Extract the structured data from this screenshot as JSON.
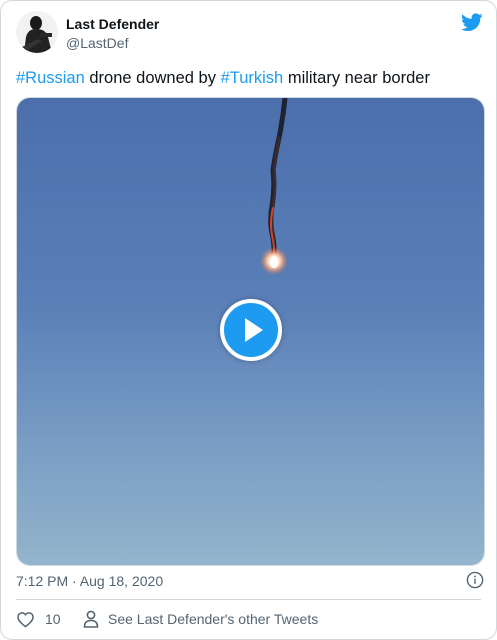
{
  "author": {
    "name": "Last Defender",
    "handle": "@LastDef"
  },
  "tweet": {
    "segments": [
      {
        "text": "#Russian",
        "hashtag": true
      },
      {
        "text": " drone downed by ",
        "hashtag": false
      },
      {
        "text": "#Turkish",
        "hashtag": true
      },
      {
        "text": " military near border",
        "hashtag": false
      }
    ],
    "timestamp": "7:12 PM · Aug 18, 2020"
  },
  "actions": {
    "like_count": "10",
    "other_tweets_label": "See Last Defender's other Tweets"
  },
  "icons": {
    "brand": "twitter-bird-icon",
    "play": "play-icon",
    "info": "info-icon",
    "like": "heart-icon",
    "profile": "person-icon"
  },
  "colors": {
    "accent": "#1d9bf0",
    "text_primary": "#0f1419",
    "text_secondary": "#536471",
    "border": "#cfd9de",
    "sky_top": "#4f72ae",
    "sky_bottom": "#8fb1cb"
  }
}
